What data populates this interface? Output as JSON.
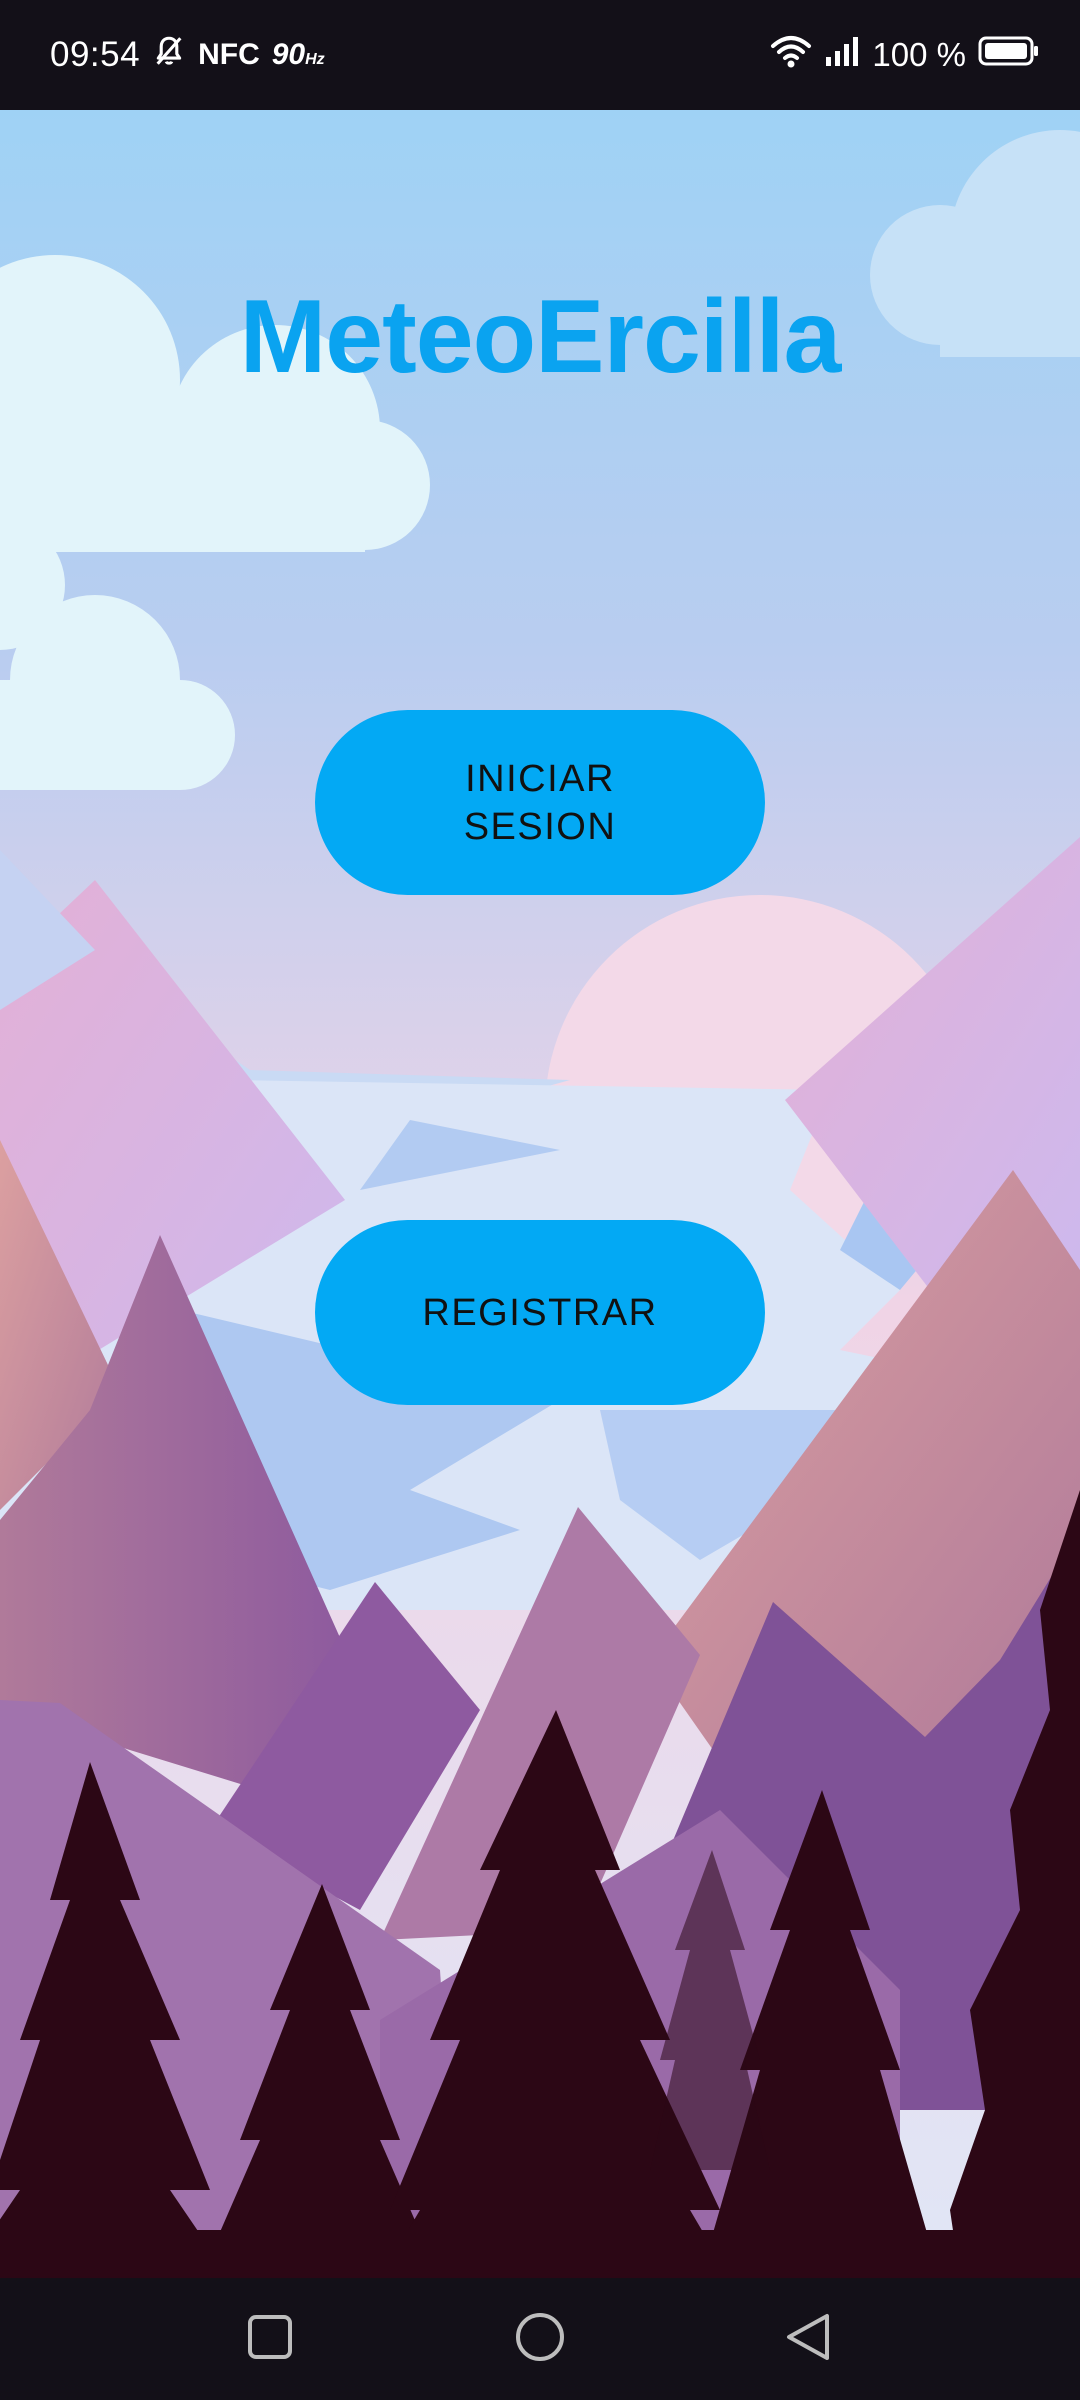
{
  "status_bar": {
    "time": "09:54",
    "nfc": "NFC",
    "refresh_rate": "90",
    "refresh_unit": "Hz",
    "battery_percent": "100 %",
    "icons": [
      "bell-off-icon",
      "wifi-icon",
      "signal-icon",
      "battery-icon"
    ]
  },
  "app": {
    "title": "MeteoErcilla",
    "title_color": "#0aa3f0"
  },
  "actions": {
    "login_label": "INICIAR\nSESION",
    "register_label": "REGISTRAR",
    "button_color": "#03a9f4"
  },
  "nav_bar": {
    "icons": [
      "recents-square-icon",
      "home-circle-icon",
      "back-triangle-icon"
    ]
  }
}
